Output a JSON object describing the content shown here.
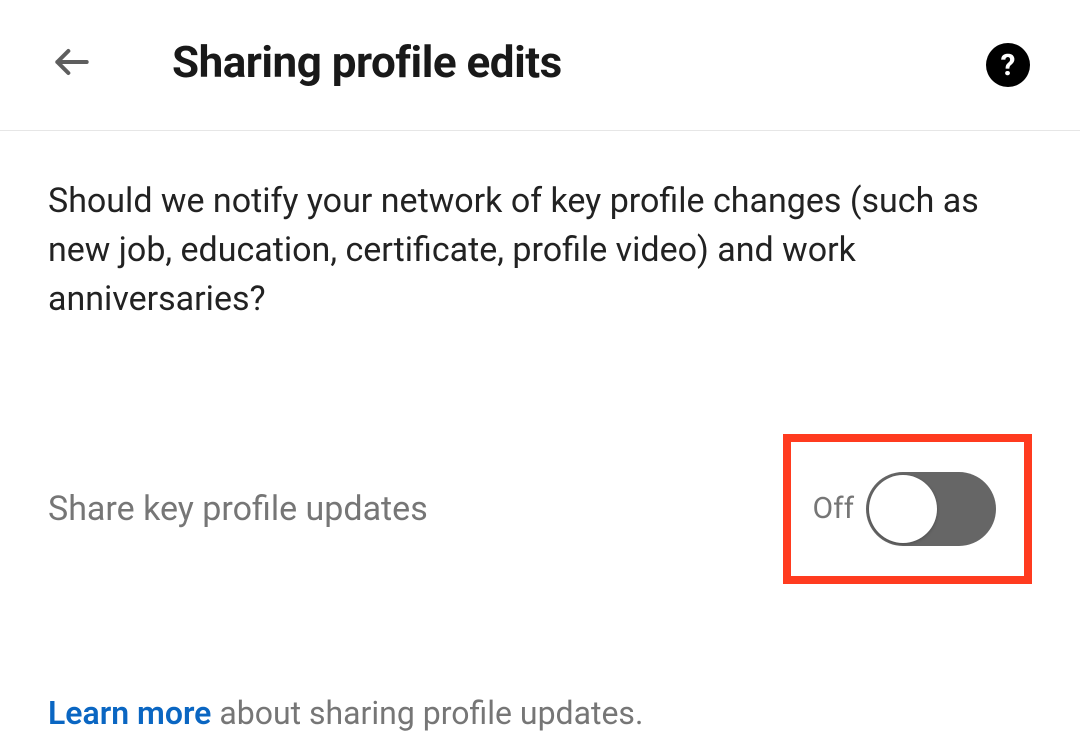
{
  "header": {
    "title": "Sharing profile edits"
  },
  "content": {
    "description": "Should we notify your network of key profile changes (such as new job, education, certificate, profile video) and work anniversaries?"
  },
  "setting": {
    "label": "Share key profile updates",
    "state": "Off"
  },
  "footer": {
    "learn_more": "Learn more",
    "learn_rest": " about sharing profile updates."
  }
}
